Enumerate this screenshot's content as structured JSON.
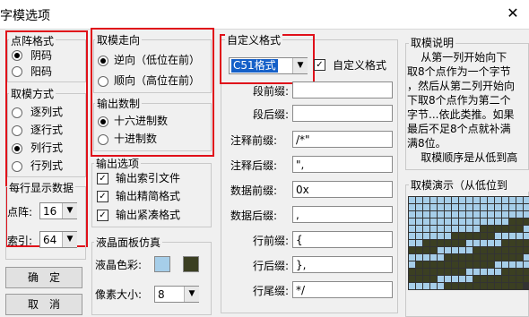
{
  "window": {
    "title": "字模选项",
    "close_glyph": "✕"
  },
  "dot_format": {
    "label": "点阵格式",
    "options": [
      {
        "label": "阴码",
        "selected": true
      },
      {
        "label": "阳码",
        "selected": false
      }
    ]
  },
  "scan_mode": {
    "label": "取模方式",
    "options": [
      {
        "label": "逐列式",
        "selected": false
      },
      {
        "label": "逐行式",
        "selected": false
      },
      {
        "label": "列行式",
        "selected": true
      },
      {
        "label": "行列式",
        "selected": false
      }
    ]
  },
  "per_line": {
    "label": "每行显示数据",
    "dot_label": "点阵:",
    "dot_value": "16",
    "index_label": "索引:",
    "index_value": "64"
  },
  "buttons": {
    "ok": "确　定",
    "cancel": "取　消"
  },
  "direction": {
    "label": "取模走向",
    "options": [
      {
        "label": "逆向（低位在前）",
        "selected": true
      },
      {
        "label": "顺向（高位在前）",
        "selected": false
      }
    ]
  },
  "number_base": {
    "label": "输出数制",
    "options": [
      {
        "label": "十六进制数",
        "selected": true
      },
      {
        "label": "十进制数",
        "selected": false
      }
    ]
  },
  "output_options": {
    "label": "输出选项",
    "items": [
      {
        "label": "输出索引文件",
        "checked": true
      },
      {
        "label": "输出精简格式",
        "checked": true
      },
      {
        "label": "输出紧凑格式",
        "checked": true
      }
    ]
  },
  "lcd": {
    "label": "液晶面板仿真",
    "color_label": "液晶色彩:",
    "pixel_label": "像素大小:",
    "pixel_value": "8",
    "colors": {
      "light": "#a6cee9",
      "dark": "#3b3f22"
    }
  },
  "custom_format": {
    "label": "自定义格式",
    "selected": "C51格式",
    "checkbox_label": "自定义格式",
    "checkbox_checked": true,
    "fields": [
      {
        "label": "段前缀:",
        "value": ""
      },
      {
        "label": "段后缀:",
        "value": ""
      },
      {
        "label": "注释前缀:",
        "value": "/*\""
      },
      {
        "label": "注释后缀:",
        "value": "\","
      },
      {
        "label": "数据前缀:",
        "value": "0x"
      },
      {
        "label": "数据后缀:",
        "value": ","
      },
      {
        "label": "行前缀:",
        "value": "{"
      },
      {
        "label": "行后缀:",
        "value": "},"
      },
      {
        "label": "行尾缀:",
        "value": "*/"
      }
    ]
  },
  "desc": {
    "label": "取模说明",
    "text": "    从第一列开始向下\n取8个点作为一个字节\n，然后从第二列开始向\n下取8个点作为第二个\n字节...依此类推。如果\n最后不足8个点就补满\n满8位。\n    取模顺序是从低到高"
  },
  "demo": {
    "label": "取模演示（从低位到"
  }
}
